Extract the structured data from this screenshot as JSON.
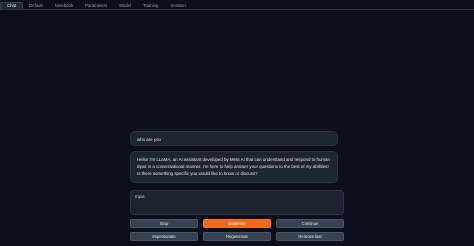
{
  "tabs": [
    "Chat",
    "Default",
    "Notebook",
    "Parameters",
    "Model",
    "Training",
    "Session"
  ],
  "chat": {
    "user_message": "who are you",
    "bot_message": "Hello! I'm LLaMA, an AI assistant developed by Meta AI that can understand and respond to human input in a conversational manner. I'm here to help answer your questions to the best of my abilities! Is there something specific you would like to know or discuss?"
  },
  "input": {
    "label": "Input",
    "value": ""
  },
  "buttons": {
    "stop": "Stop",
    "generate": "Generate",
    "continue": "Continue",
    "impersonate": "Impersonate",
    "regenerate": "Regenerate",
    "remove_last": "Remove last"
  },
  "colors": {
    "background": "#0b0f19",
    "accent": "#f26a1b"
  }
}
